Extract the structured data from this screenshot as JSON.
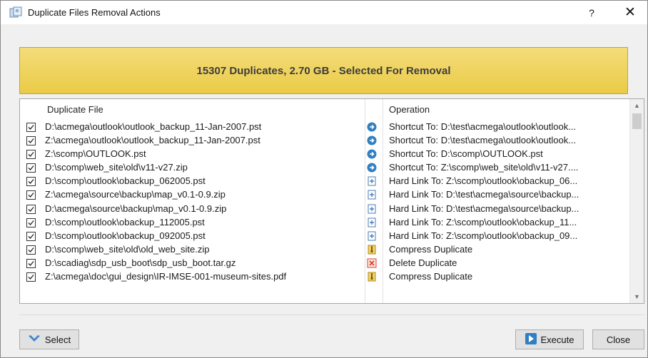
{
  "window": {
    "title": "Duplicate Files Removal Actions",
    "help_label": "?",
    "close_label": "✕"
  },
  "banner": {
    "text": "15307 Duplicates, 2.70 GB - Selected For Removal"
  },
  "table": {
    "columns": [
      "Duplicate File",
      "Operation"
    ],
    "rows": [
      {
        "file": "D:\\acmega\\outlook\\outlook_backup_11-Jan-2007.pst",
        "op": "Shortcut To: D:\\test\\acmega\\outlook\\outlook...",
        "icon": "shortcut"
      },
      {
        "file": "Z:\\acmega\\outlook\\outlook_backup_11-Jan-2007.pst",
        "op": "Shortcut To: D:\\test\\acmega\\outlook\\outlook...",
        "icon": "shortcut"
      },
      {
        "file": "Z:\\scomp\\OUTLOOK.pst",
        "op": "Shortcut To: D:\\scomp\\OUTLOOK.pst",
        "icon": "shortcut"
      },
      {
        "file": "D:\\scomp\\web_site\\old\\v11-v27.zip",
        "op": "Shortcut To: Z:\\scomp\\web_site\\old\\v11-v27....",
        "icon": "shortcut"
      },
      {
        "file": "D:\\scomp\\outlook\\obackup_062005.pst",
        "op": "Hard Link To: Z:\\scomp\\outlook\\obackup_06...",
        "icon": "hardlink"
      },
      {
        "file": "Z:\\acmega\\source\\backup\\map_v0.1-0.9.zip",
        "op": "Hard Link To: D:\\test\\acmega\\source\\backup...",
        "icon": "hardlink"
      },
      {
        "file": "D:\\acmega\\source\\backup\\map_v0.1-0.9.zip",
        "op": "Hard Link To: D:\\test\\acmega\\source\\backup...",
        "icon": "hardlink"
      },
      {
        "file": "D:\\scomp\\outlook\\obackup_112005.pst",
        "op": "Hard Link To: Z:\\scomp\\outlook\\obackup_11...",
        "icon": "hardlink"
      },
      {
        "file": "D:\\scomp\\outlook\\obackup_092005.pst",
        "op": "Hard Link To: Z:\\scomp\\outlook\\obackup_09...",
        "icon": "hardlink"
      },
      {
        "file": "D:\\scomp\\web_site\\old\\old_web_site.zip",
        "op": "Compress Duplicate",
        "icon": "compress"
      },
      {
        "file": "D:\\scadiag\\sdp_usb_boot\\sdp_usb_boot.tar.gz",
        "op": "Delete Duplicate",
        "icon": "delete"
      },
      {
        "file": "Z:\\acmega\\doc\\gui_design\\IR-IMSE-001-museum-sites.pdf",
        "op": "Compress Duplicate",
        "icon": "compress"
      }
    ]
  },
  "buttons": {
    "select": "Select",
    "execute": "Execute",
    "close": "Close"
  },
  "colors": {
    "banner": "#eacb46",
    "shortcut_icon": "#2f7fc1",
    "delete_icon": "#d9442b"
  }
}
